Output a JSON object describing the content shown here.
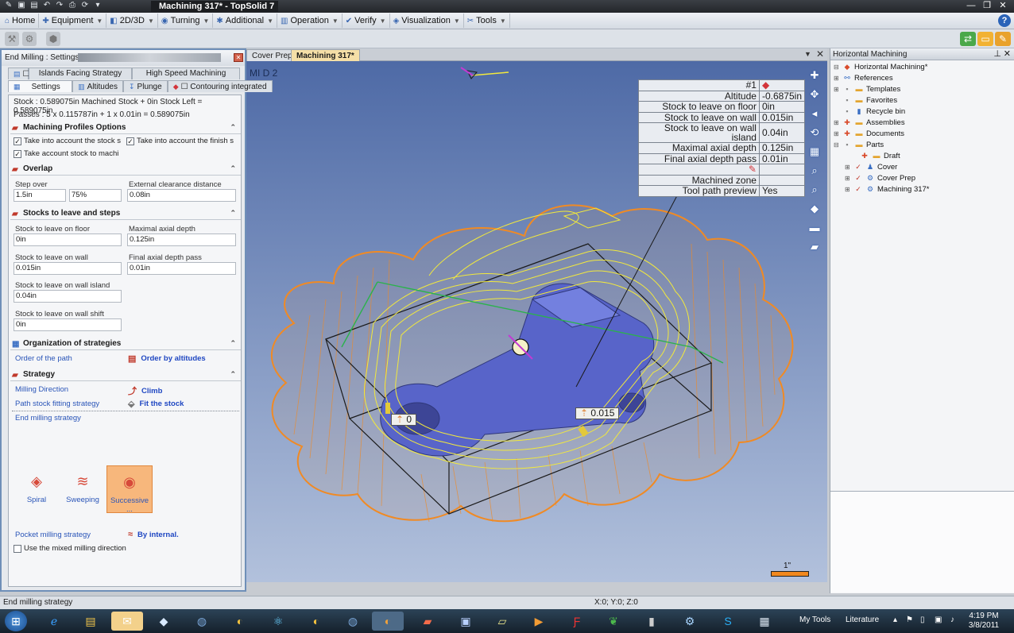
{
  "window": {
    "title": "Machining 317* - TopSolid 7",
    "minimize": "—",
    "maximize": "❐",
    "close": "✕"
  },
  "menubar": {
    "items": [
      {
        "label": "Home"
      },
      {
        "label": "Equipment"
      },
      {
        "label": "2D/3D"
      },
      {
        "label": "Turning"
      },
      {
        "label": "Additional"
      },
      {
        "label": "Operation"
      },
      {
        "label": "Verify"
      },
      {
        "label": "Visualization"
      },
      {
        "label": "Tools"
      }
    ],
    "help": "?"
  },
  "doc_tabs": {
    "tabs": [
      {
        "label": "Cover Prep"
      },
      {
        "label": "Machining 317*"
      }
    ],
    "dropdown": "▼",
    "close": "✕"
  },
  "viewport": {
    "label": "MI D 2",
    "properties": [
      {
        "key": "#1",
        "value": ""
      },
      {
        "key": "Altitude",
        "value": "-0.6875in"
      },
      {
        "key": "Stock to leave on floor",
        "value": "0in"
      },
      {
        "key": "Stock to leave on wall",
        "value": "0.015in"
      },
      {
        "key": "Stock to leave on wall island",
        "value": "0.04in"
      },
      {
        "key": "Maximal axial depth",
        "value": "0.125in"
      },
      {
        "key": "Final axial depth pass",
        "value": "0.01in"
      },
      {
        "key": "",
        "value": ""
      },
      {
        "key": "Machined zone",
        "value": ""
      },
      {
        "key": "Tool path preview",
        "value": "Yes"
      }
    ],
    "callout_a": "0",
    "callout_b": "0.015",
    "scale_label": "1\""
  },
  "settings_panel": {
    "title": "End Milling : Settings",
    "close": "✕",
    "tabs_row1": [
      {
        "label": "Islands Facing Strategy"
      },
      {
        "label": "High Speed Machining"
      }
    ],
    "tabs_row2": [
      {
        "label": "Settings"
      },
      {
        "label": "Altitudes"
      },
      {
        "label": "Plunge"
      },
      {
        "label": "Contouring integrated"
      }
    ],
    "stock_info": "Stock : 0.589075in Machined Stock + 0in Stock Left = 0.589075in",
    "passes_info": "Passes : 5 x 0.115787in + 1 x 0.01in = 0.589075in",
    "profiles": {
      "title": "Machining Profiles Options",
      "check1": "Take into account the stock s",
      "check2": "Take into account the finish s",
      "check3": "Take account stock to machi"
    },
    "overlap": {
      "title": "Overlap",
      "step_over_label": "Step over",
      "step_over_value": "1.5in",
      "step_over_pct": "75%",
      "ext_clearance_label": "External clearance distance",
      "ext_clearance_value": "0.08in"
    },
    "stocks": {
      "title": "Stocks to leave and steps",
      "floor_label": "Stock to leave on floor",
      "floor_value": "0in",
      "max_axial_label": "Maximal axial depth",
      "max_axial_value": "0.125in",
      "wall_label": "Stock to leave on wall",
      "wall_value": "0.015in",
      "final_axial_label": "Final axial depth pass",
      "final_axial_value": "0.01in",
      "wall_island_label": "Stock to leave on wall island",
      "wall_island_value": "0.04in",
      "wall_shift_label": "Stock to leave on wall shift",
      "wall_shift_value": "0in"
    },
    "organization": {
      "title": "Organization of strategies",
      "order_label": "Order of the path",
      "order_value": "Order by altitudes"
    },
    "strategy": {
      "title": "Strategy",
      "direction_label": "Milling Direction",
      "direction_value": "Climb",
      "fitting_label": "Path stock fitting strategy",
      "fitting_value": "Fit the stock",
      "end_milling_label": "End milling strategy",
      "options": [
        {
          "label": "Spiral"
        },
        {
          "label": "Sweeping"
        },
        {
          "label": "Successive ..."
        }
      ],
      "pocket_label": "Pocket milling strategy",
      "pocket_value": "By internal.",
      "mixed_label": "Use the mixed milling direction"
    },
    "collapse": "⌃"
  },
  "tree_panel": {
    "title": "Horizontal Machining",
    "nodes": [
      {
        "label": "Horizontal Machining*"
      },
      {
        "label": "References"
      },
      {
        "label": "Templates"
      },
      {
        "label": "Favorites"
      },
      {
        "label": "Recycle bin"
      },
      {
        "label": "Assemblies"
      },
      {
        "label": "Documents"
      },
      {
        "label": "Parts"
      },
      {
        "label": "Draft"
      },
      {
        "label": "Cover"
      },
      {
        "label": "Cover Prep"
      },
      {
        "label": "Machining 317*"
      }
    ]
  },
  "statusbar": {
    "text": "End milling strategy",
    "coords": "X:0; Y:0; Z:0"
  },
  "taskbar": {
    "my_tools": "My Tools",
    "literature": "Literature",
    "time": "4:19 PM",
    "date": "3/8/2011"
  },
  "colors": {
    "accent": "#3866b0",
    "panel_border": "#6f8fb8",
    "toolpath_yellow": "#f2e93c",
    "toolpath_orange": "#f08a24",
    "part_blue": "#5864c9"
  }
}
